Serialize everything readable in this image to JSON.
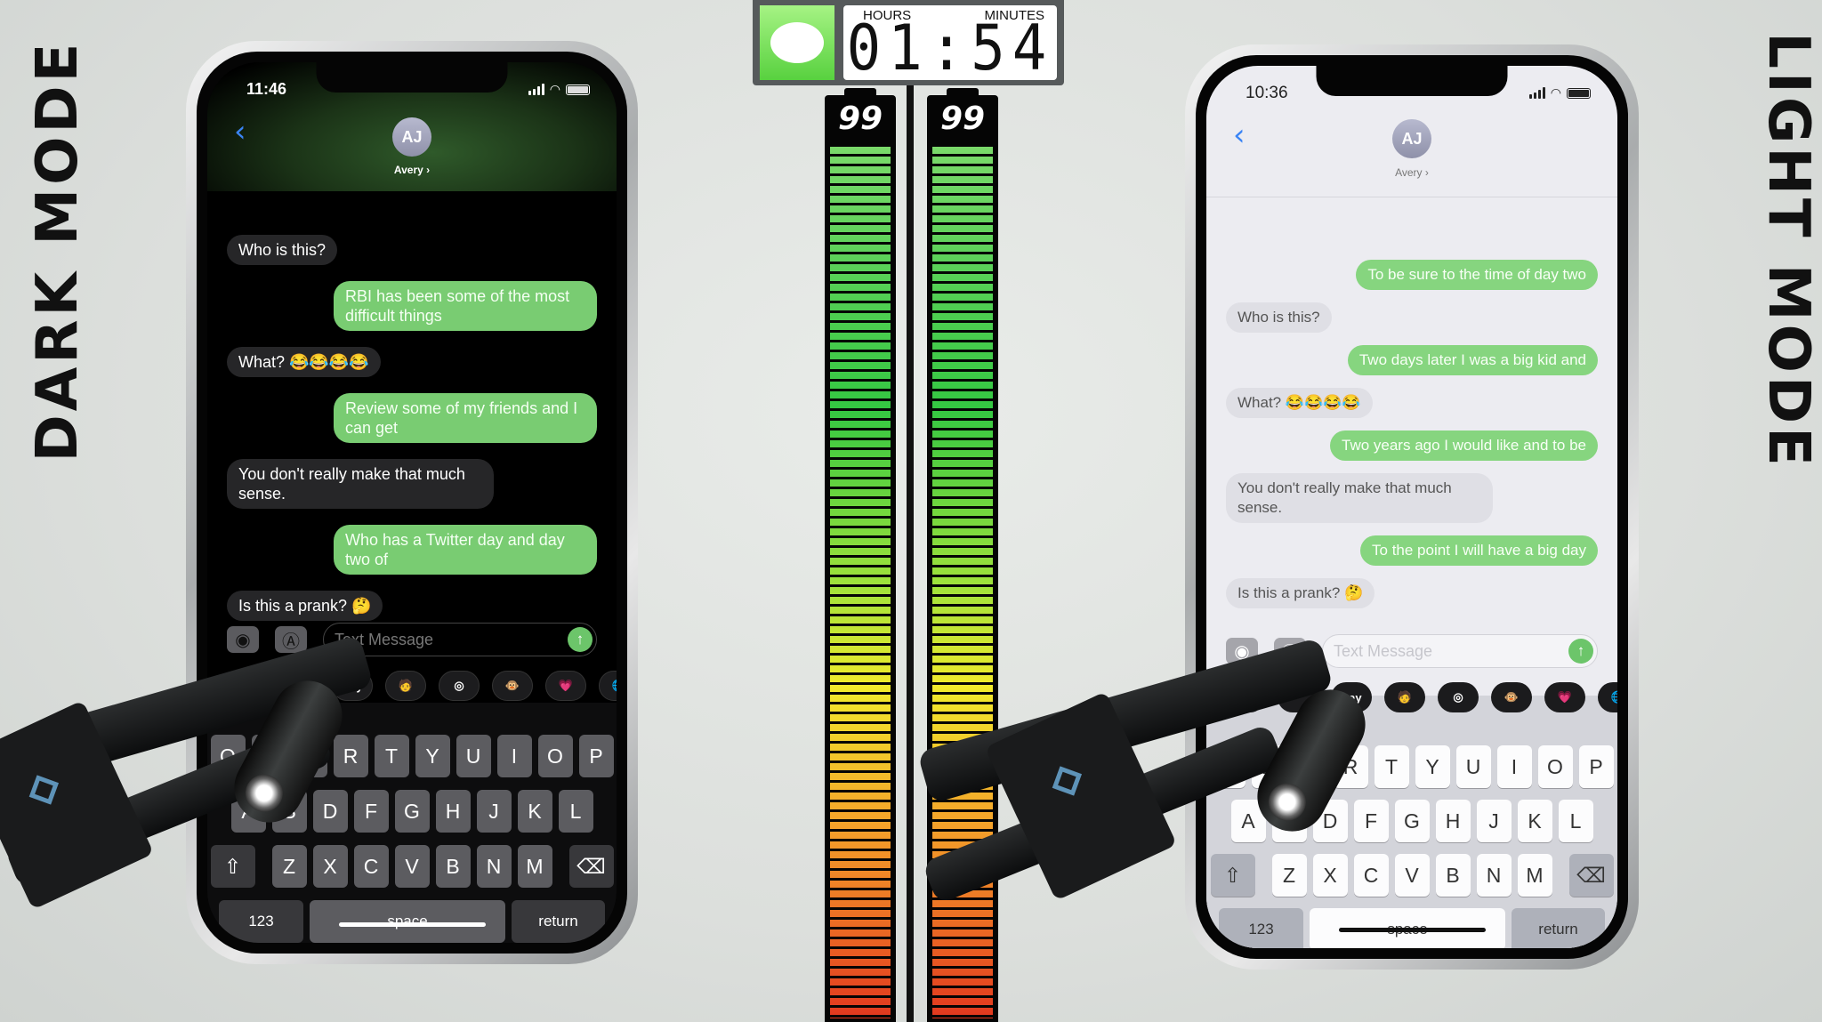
{
  "labels": {
    "dark_mode": "DARK MODE",
    "light_mode": "LIGHT MODE"
  },
  "timer": {
    "hours_label": "HOURS",
    "minutes_label": "MINUTES",
    "value": "01:54",
    "app_icon": "messages-icon"
  },
  "batteries": {
    "left_percent": 99,
    "right_percent": 99,
    "left_label": "99",
    "right_label": "99",
    "colors": {
      "top": "#34c742",
      "middle": "#f1ea2c",
      "bottom": "#e2381f"
    }
  },
  "colors": {
    "outgoing_bubble": "#79cc72",
    "ios_blue": "#3a84f5",
    "dark_background": "#000000",
    "light_background": "#ececf1"
  },
  "dark_phone": {
    "time": "11:46",
    "contact_initials": "AJ",
    "contact_name": "Avery ›",
    "messages": [
      {
        "side": "in",
        "text": "Who is this?"
      },
      {
        "side": "out",
        "text": "RBI has been some of the most difficult things"
      },
      {
        "side": "in",
        "text": "What? 😂😂😂😂"
      },
      {
        "side": "out",
        "text": "Review some of my friends and I can get"
      },
      {
        "side": "in",
        "text": "You don't really make that much sense."
      },
      {
        "side": "out",
        "text": "Who has a Twitter day and day two of"
      },
      {
        "side": "in",
        "text": "Is this a prank? 🤔"
      }
    ],
    "input_placeholder": "Text Message"
  },
  "light_phone": {
    "time": "10:36",
    "contact_initials": "AJ",
    "contact_name": "Avery ›",
    "messages": [
      {
        "side": "out",
        "text": "To be sure to the time of day two"
      },
      {
        "side": "in",
        "text": "Who is this?"
      },
      {
        "side": "out",
        "text": "Two days later I was a big kid and"
      },
      {
        "side": "in",
        "text": "What? 😂😂😂😂"
      },
      {
        "side": "out",
        "text": "Two years ago I would like and to be"
      },
      {
        "side": "in",
        "text": "You don't really make that much sense."
      },
      {
        "side": "out",
        "text": "To the point I will have a big day"
      },
      {
        "side": "in",
        "text": "Is this a prank? 🤔"
      }
    ],
    "input_placeholder": "Text Message"
  },
  "app_strip": [
    {
      "name": "photos-app",
      "label": ""
    },
    {
      "name": "app-store-app",
      "label": ""
    },
    {
      "name": "apple-pay-app",
      "label": "Pay"
    },
    {
      "name": "memoji-app",
      "label": "🧑"
    },
    {
      "name": "activity-app",
      "label": "◎"
    },
    {
      "name": "animoji-app",
      "label": "🐵"
    },
    {
      "name": "digital-touch-app",
      "label": "💗"
    },
    {
      "name": "web-search-app",
      "label": "🌐"
    }
  ],
  "keyboard": {
    "rows": [
      [
        "Q",
        "W",
        "E",
        "R",
        "T",
        "Y",
        "U",
        "I",
        "O",
        "P"
      ],
      [
        "A",
        "S",
        "D",
        "F",
        "G",
        "H",
        "J",
        "K",
        "L"
      ],
      [
        "⇧",
        "Z",
        "X",
        "C",
        "V",
        "B",
        "N",
        "M",
        "⌫"
      ]
    ],
    "numbers": "123",
    "space": "space",
    "return": "return",
    "emoji_icon": "emoji-icon",
    "mic_icon": "microphone-icon"
  }
}
